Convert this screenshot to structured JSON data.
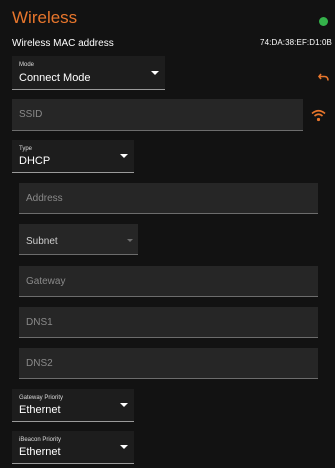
{
  "header": {
    "title": "Wireless",
    "status_color": "#34b24a"
  },
  "mac": {
    "label": "Wireless MAC address",
    "value": "74:DA:38:EF:D1:0B"
  },
  "mode": {
    "label": "Mode",
    "value": "Connect Mode",
    "undo_icon": "undo-arrow-icon"
  },
  "ssid": {
    "placeholder": "SSID",
    "value": "",
    "wifi_icon": "wifi-icon",
    "accent": "#e8762c"
  },
  "type": {
    "label": "Type",
    "value": "DHCP"
  },
  "address": {
    "placeholder": "Address"
  },
  "subnet": {
    "label": "Subnet"
  },
  "gateway": {
    "placeholder": "Gateway"
  },
  "dns1": {
    "placeholder": "DNS1"
  },
  "dns2": {
    "placeholder": "DNS2"
  },
  "gateway_priority": {
    "label": "Gateway Priority",
    "value": "Ethernet"
  },
  "ibeacon_priority": {
    "label": "iBeacon Priority",
    "value": "Ethernet"
  }
}
